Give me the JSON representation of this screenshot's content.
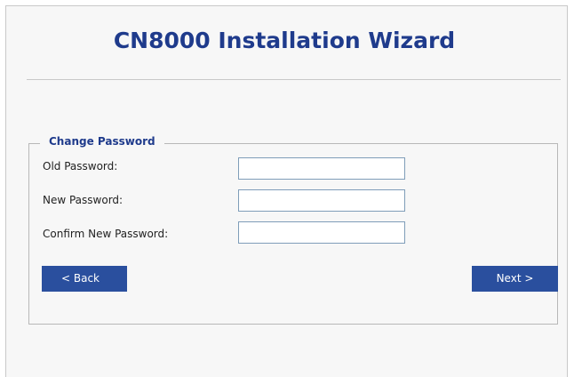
{
  "wizard": {
    "title": "CN8000 Installation Wizard"
  },
  "change_password": {
    "legend": "Change Password",
    "fields": [
      {
        "label": "Old Password:",
        "value": ""
      },
      {
        "label": "New Password:",
        "value": ""
      },
      {
        "label": "Confirm New Password:",
        "value": ""
      }
    ]
  },
  "buttons": {
    "back_label": "< Back",
    "next_label": "Next >"
  },
  "colors": {
    "accent": "#1f3b8c",
    "button_bg": "#2a4f9e",
    "panel_bg": "#f7f7f7"
  }
}
